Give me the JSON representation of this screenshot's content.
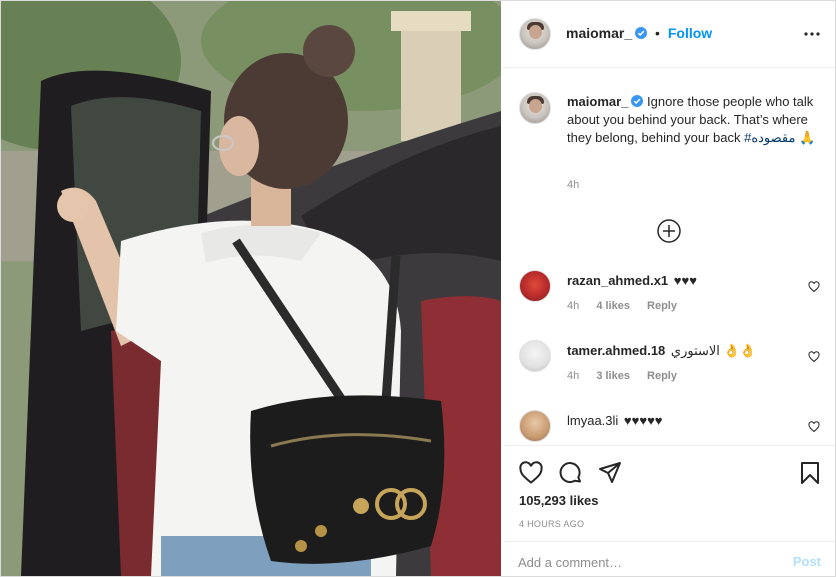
{
  "post": {
    "username": "maiomar_",
    "follow_label": "Follow",
    "dot": "•",
    "caption": {
      "text": "Ignore those people who talk about you behind your back. That’s where they belong, behind your back",
      "hashtag": "#مقصوده",
      "emoji": "🙏",
      "time": "4h"
    },
    "likes": "105,293 likes",
    "time_ago": "4 HOURS AGO"
  },
  "comments": [
    {
      "username": "razan_ahmed.x1",
      "text": "♥♥♥",
      "time": "4h",
      "likes": "4 likes",
      "reply": "Reply"
    },
    {
      "username": "tamer.ahmed.18",
      "text": "الاستوري 👌👌",
      "time": "4h",
      "likes": "3 likes",
      "reply": "Reply"
    },
    {
      "username": "lmyaa.3li",
      "text": "♥♥♥♥♥",
      "time": "",
      "likes": "",
      "reply": ""
    }
  ],
  "add_comment": {
    "placeholder": "Add a comment…",
    "post_label": "Post"
  },
  "icons": {
    "verified": "verified-badge-icon",
    "more": "more-options-icon",
    "load_more": "load-more-comments-icon",
    "like": "heart-icon",
    "comment": "comment-icon",
    "share": "share-icon",
    "save": "bookmark-icon"
  },
  "colors": {
    "accent": "#0095f6",
    "verified": "#3897f0",
    "muted": "#8e8e8e",
    "post_disabled": "#b2dffc"
  }
}
